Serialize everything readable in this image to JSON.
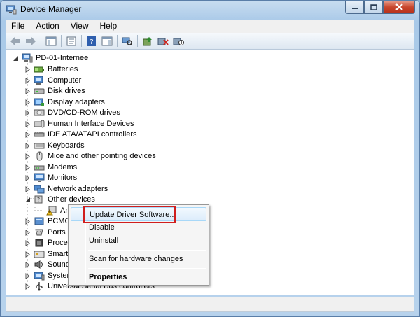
{
  "window": {
    "title": "Device Manager"
  },
  "menu": [
    "File",
    "Action",
    "View",
    "Help"
  ],
  "tree": {
    "root": "PD-01-Internee",
    "categories": [
      {
        "label": "Batteries",
        "icon": "battery-icon"
      },
      {
        "label": "Computer",
        "icon": "computer-icon"
      },
      {
        "label": "Disk drives",
        "icon": "disk-drive-icon"
      },
      {
        "label": "Display adapters",
        "icon": "display-adapter-icon"
      },
      {
        "label": "DVD/CD-ROM drives",
        "icon": "dvd-drive-icon"
      },
      {
        "label": "Human Interface Devices",
        "icon": "hid-icon"
      },
      {
        "label": "IDE ATA/ATAPI controllers",
        "icon": "ide-controller-icon"
      },
      {
        "label": "Keyboards",
        "icon": "keyboard-icon"
      },
      {
        "label": "Mice and other pointing devices",
        "icon": "mouse-icon"
      },
      {
        "label": "Modems",
        "icon": "modem-icon"
      },
      {
        "label": "Monitors",
        "icon": "monitor-icon"
      },
      {
        "label": "Network adapters",
        "icon": "network-adapter-icon"
      },
      {
        "label": "Other devices",
        "icon": "other-devices-icon"
      },
      {
        "label": "And",
        "icon": "warning-device-icon"
      },
      {
        "label": "PCMCIA",
        "icon": "pcmcia-icon"
      },
      {
        "label": "Ports (C",
        "icon": "port-icon"
      },
      {
        "label": "Process",
        "icon": "processor-icon"
      },
      {
        "label": "Smart c",
        "icon": "smartcard-icon"
      },
      {
        "label": "Sound,",
        "icon": "sound-icon"
      },
      {
        "label": "System",
        "icon": "system-icon"
      },
      {
        "label": "Universal Serial Bus controllers",
        "icon": "usb-icon"
      }
    ]
  },
  "context_menu": {
    "items": [
      {
        "label": "Update Driver Software...",
        "bold": false
      },
      {
        "label": "Disable",
        "bold": false
      },
      {
        "label": "Uninstall",
        "bold": false
      },
      {
        "label": "Scan for hardware changes",
        "bold": false
      },
      {
        "label": "Properties",
        "bold": true
      }
    ]
  },
  "colors": {
    "highlight_box": "#d01e1e",
    "title_gradient": "#a9c9e8"
  }
}
